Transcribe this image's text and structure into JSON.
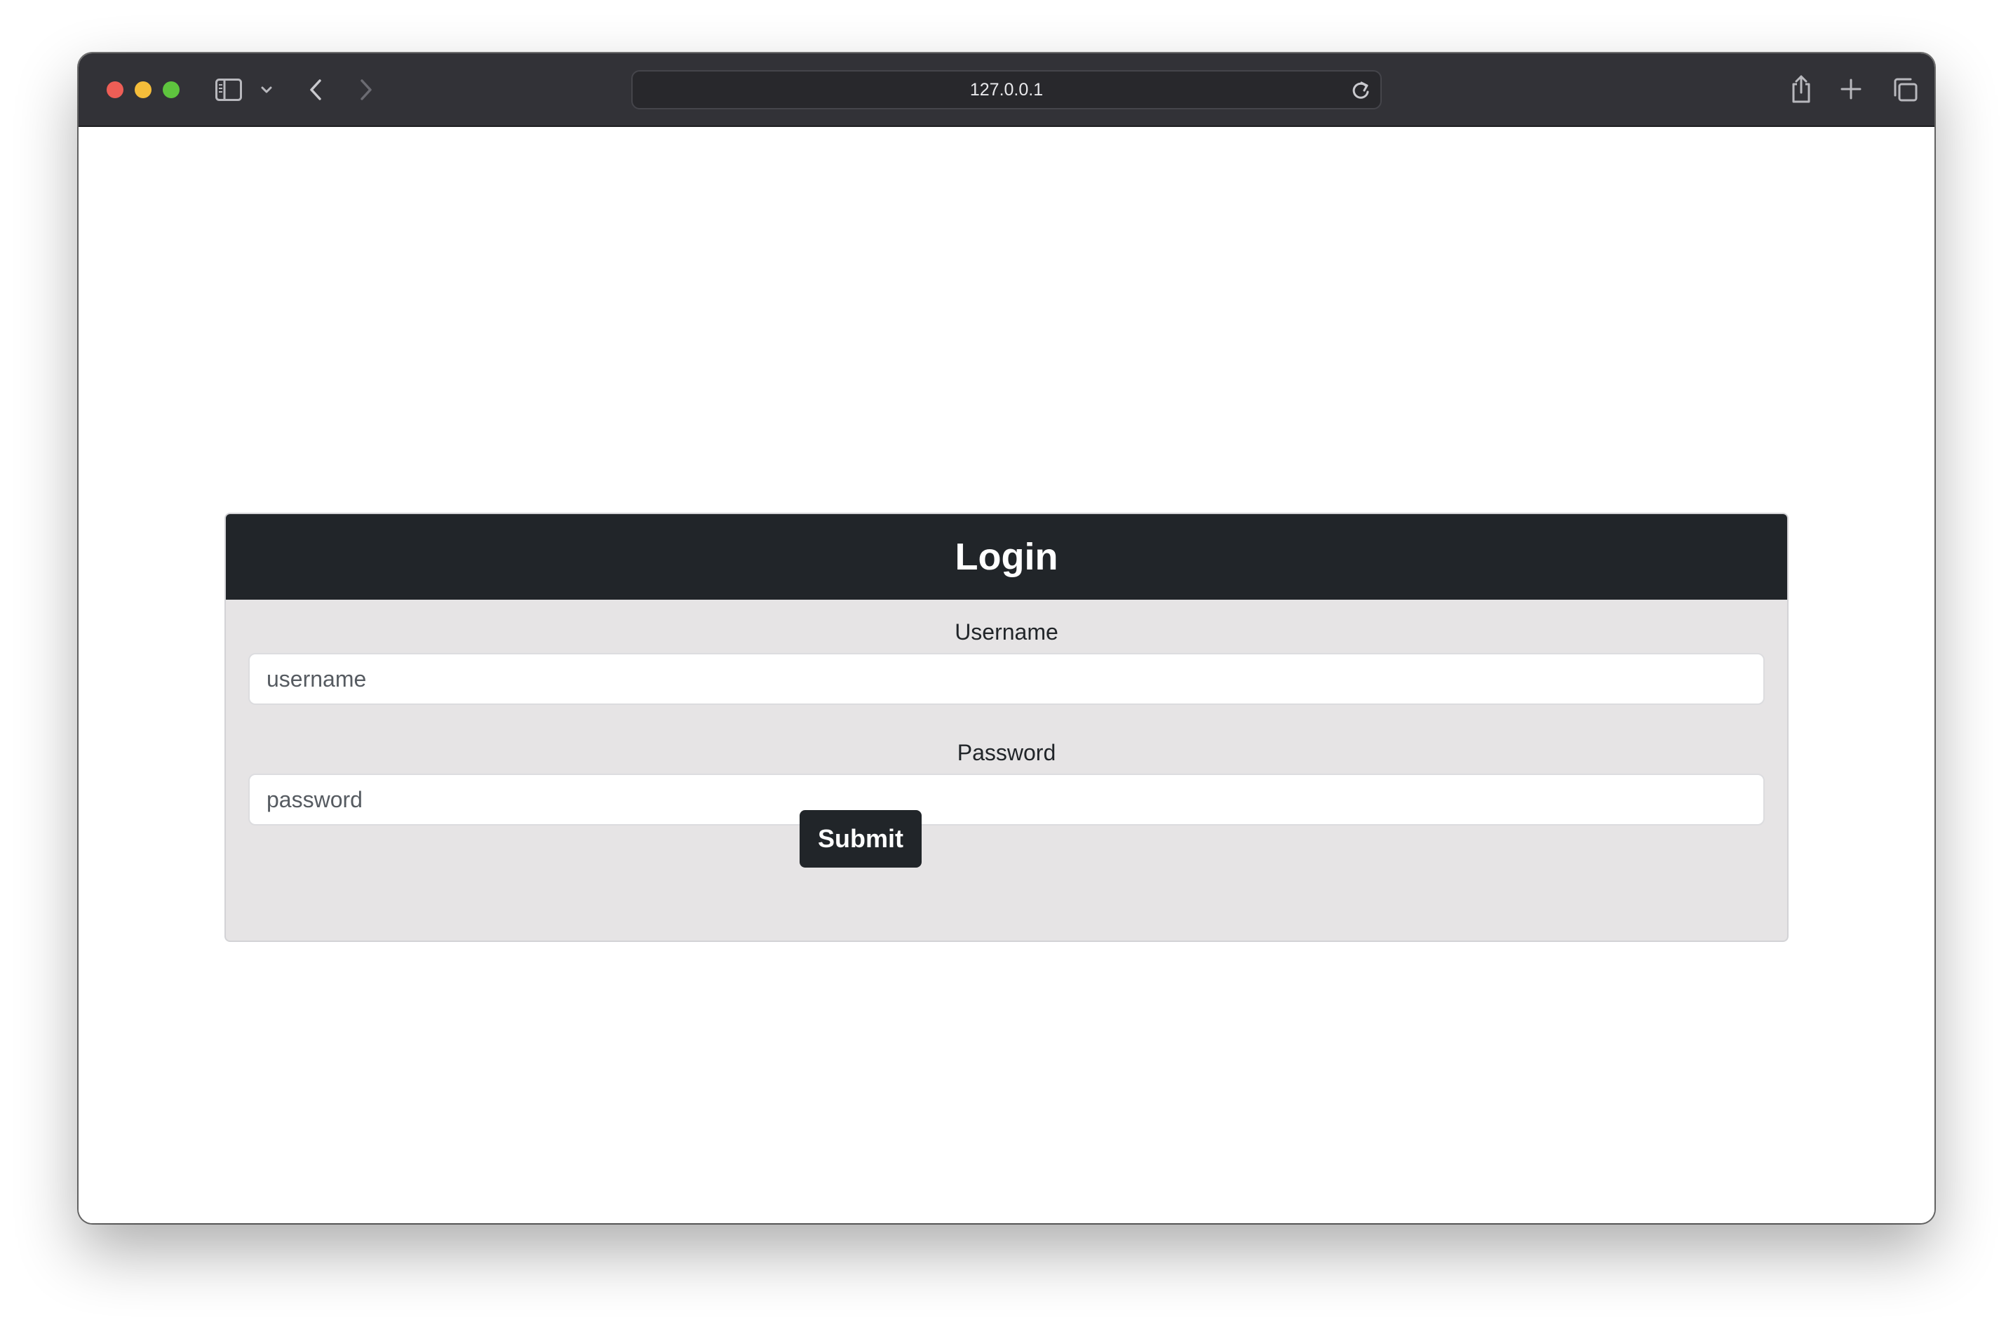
{
  "browser": {
    "url": "127.0.0.1",
    "icons": {
      "sidebar": "sidebar-icon",
      "sidebar_menu": "chevron-down-icon",
      "back": "chevron-left-icon",
      "forward": "chevron-right-icon",
      "reload": "reload-icon",
      "share": "share-icon",
      "new_tab": "plus-icon",
      "tabs": "tabs-overview-icon"
    }
  },
  "login": {
    "title": "Login",
    "username_label": "Username",
    "username_placeholder": "username",
    "password_label": "Password",
    "password_placeholder": "password",
    "submit_label": "Submit"
  },
  "colors": {
    "header_bg": "#212529",
    "card_bg": "#e6e4e5",
    "toolbar_bg": "#323237"
  }
}
